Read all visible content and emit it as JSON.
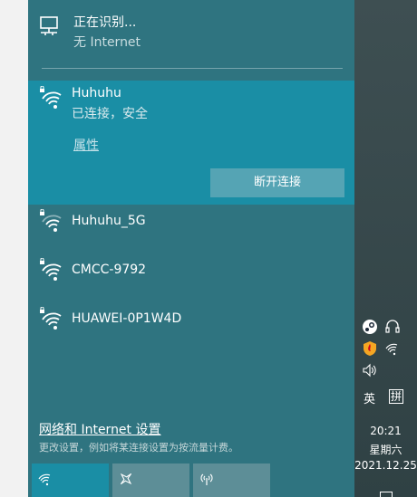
{
  "ethernet": {
    "name": "正在识别...",
    "status": "无 Internet",
    "icon": "ethernet-monitor-icon"
  },
  "networks": [
    {
      "name": "Huhuhu",
      "status": "已连接，安全",
      "properties_label": "属性",
      "action_label": "断开连接",
      "selected": true,
      "secured": true
    },
    {
      "name": "Huhuhu_5G",
      "secured": true
    },
    {
      "name": "CMCC-9792",
      "secured": true
    },
    {
      "name": "HUAWEI-0P1W4D",
      "secured": true
    }
  ],
  "settings": {
    "link_label": "网络和 Internet 设置",
    "description": "更改设置，例如将某连接设置为按流量计费。"
  },
  "quick_actions": [
    {
      "name": "wifi",
      "icon": "wifi-icon",
      "active": true
    },
    {
      "name": "airplane-mode",
      "icon": "airplane-icon",
      "active": false
    },
    {
      "name": "mobile-hotspot",
      "icon": "hotspot-icon",
      "active": false
    }
  ],
  "tray": {
    "icons": [
      "steam-icon",
      "headset-icon",
      "shield-icon",
      "wifi-icon",
      "volume-icon"
    ],
    "ime_language": "英",
    "ime_mode": "拼",
    "time": "20:21",
    "weekday": "星期六",
    "date": "2021.12.25"
  },
  "colors": {
    "flyout_bg": "#2f7480",
    "selected_bg": "#1a8ea5",
    "button_bg": "#55a4b4",
    "tile_active": "#1a8ea5",
    "tile_inactive": "#5d8e97"
  }
}
